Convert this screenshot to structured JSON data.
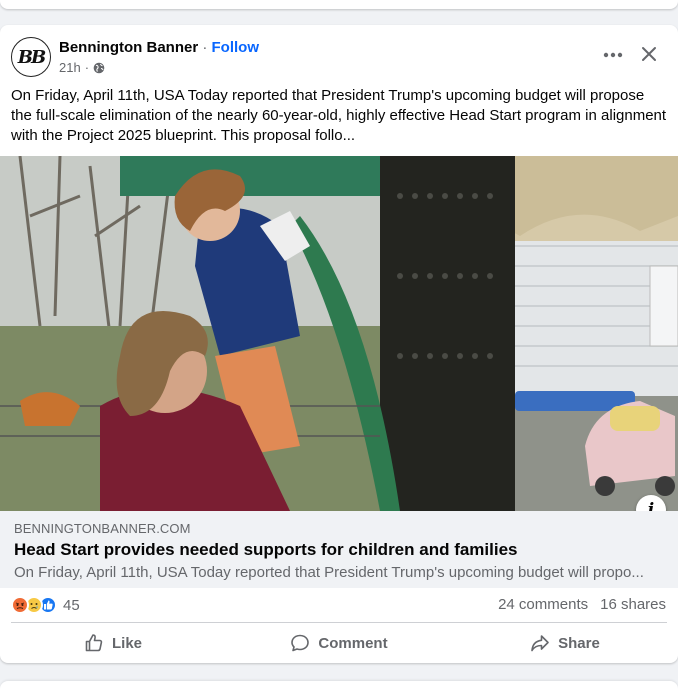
{
  "post": {
    "page_name": "Bennington Banner",
    "separator": "·",
    "follow_label": "Follow",
    "avatar_text": "BB",
    "time": "21h",
    "text": "On Friday, April 11th, USA Today reported that President Trump's upcoming budget will propose the full-scale elimination of the nearly 60-year-old, highly effective Head Start program in alignment with the Project 2025 blueprint. This proposal follo..."
  },
  "link": {
    "domain": "BENNINGTONBANNER.COM",
    "title": "Head Start provides needed supports for children and families",
    "description": "On Friday, April 11th, USA Today reported that President Trump's upcoming budget will propo...",
    "info_glyph": "i"
  },
  "engagement": {
    "reaction_count": "45",
    "reaction_icons": [
      "angry-icon",
      "sad-icon",
      "like-icon"
    ],
    "comments": "24 comments",
    "shares": "16 shares"
  },
  "actions": {
    "like": "Like",
    "comment": "Comment",
    "share": "Share"
  },
  "colors": {
    "accent": "#0866ff",
    "secondary_text": "#65676b",
    "background": "#f0f2f5"
  }
}
